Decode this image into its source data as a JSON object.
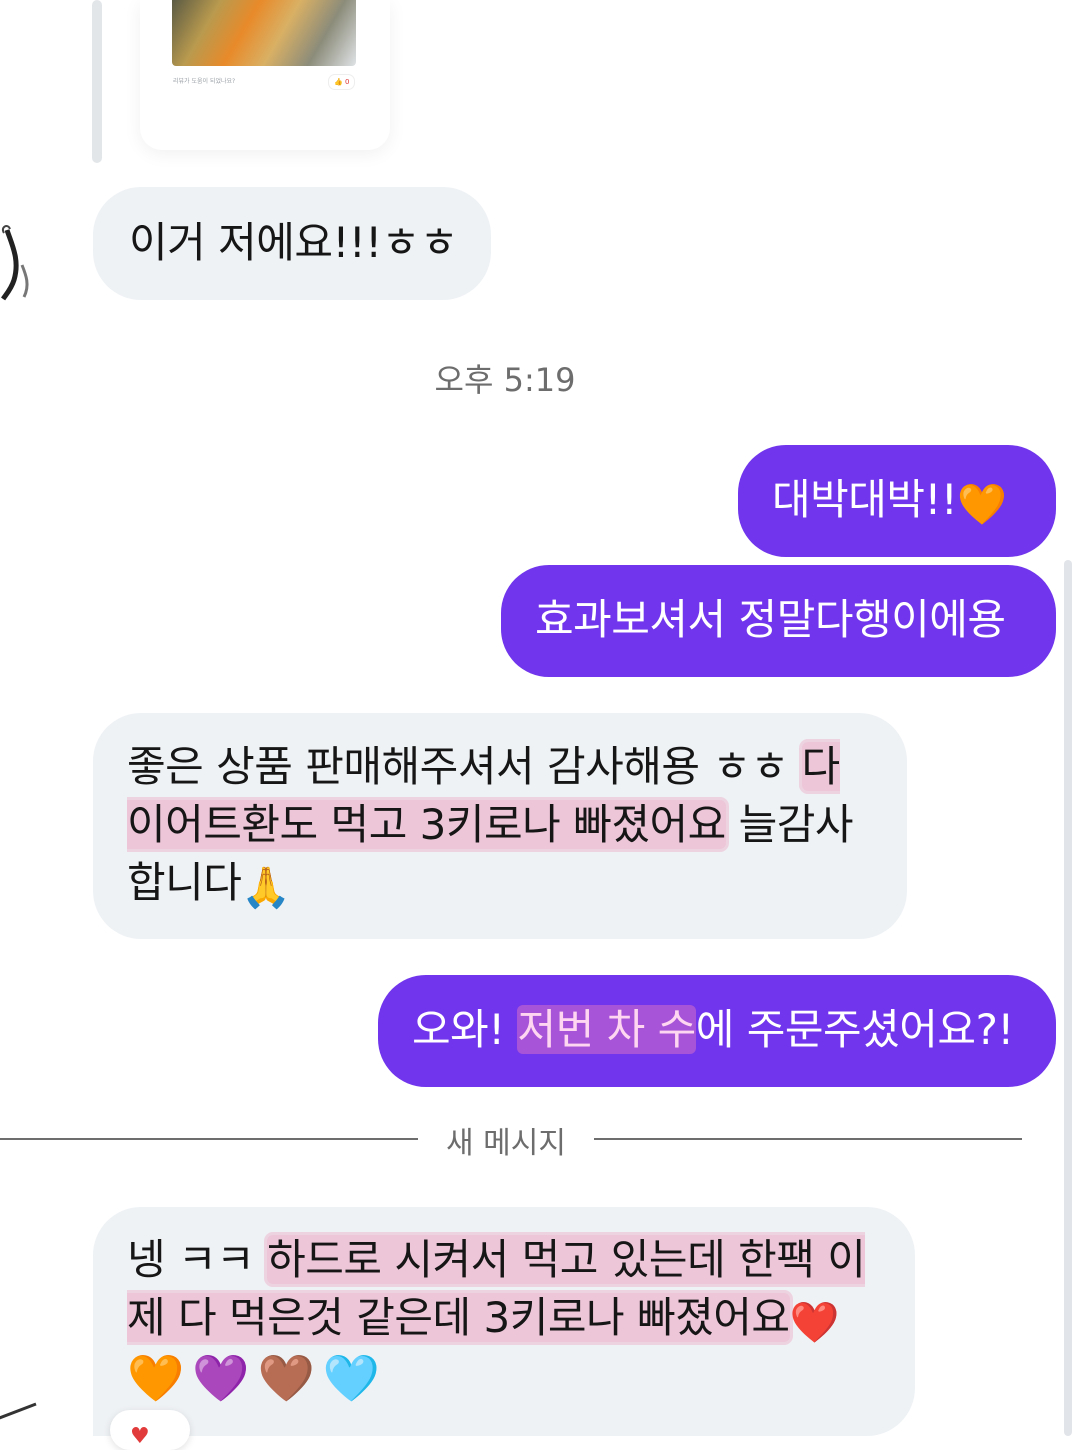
{
  "shared_review": {
    "caption": "리뷰가 도움이 되었나요?",
    "likes": "0"
  },
  "messages": [
    {
      "side": "in",
      "text": "이거 저에요!!!ㅎㅎ"
    },
    {
      "side": "out",
      "text": "대박대박!!",
      "emoji": "🧡"
    },
    {
      "side": "out",
      "text": "효과보셔서 정말다행이에용"
    },
    {
      "side": "in",
      "text_a": "좋은 상품 판매해주셔서 감사해용 ㅎㅎ ",
      "text_hl": "다이어트환도 먹고 3키로나 빠졌어요",
      "text_b": " 늘감사합니다",
      "emoji": "🙏"
    },
    {
      "side": "out",
      "text_a": "오와! ",
      "text_hl": "저번 차 수",
      "text_b": "에 주문주셨어요?!"
    },
    {
      "side": "in",
      "text_a": "넹 ㅋㅋ ",
      "text_hl": "하드로 시켜서 먹고 있는데 한팩 이제 다 먹은것 같은데 3키로나 빠졌어요",
      "emoji_red": "❤️",
      "emojis": "🧡💜🤎🩵"
    }
  ],
  "timestamp": "오후 5:19",
  "new_messages_label": "새 메시지",
  "reaction_heart": "♥",
  "colors": {
    "outgoing_bubble": "#7035ec",
    "incoming_bubble": "#eff2f5",
    "highlight": "#e98ab0"
  }
}
